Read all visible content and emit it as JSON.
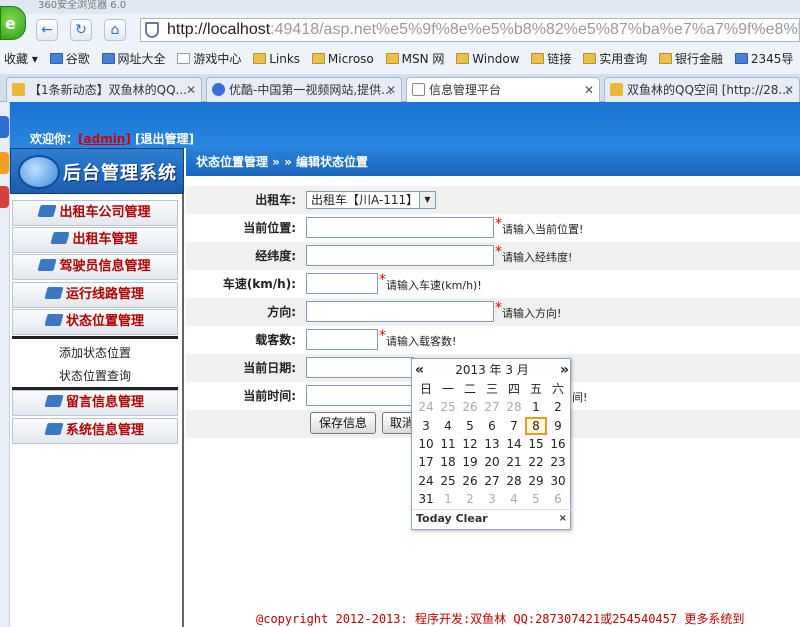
{
  "browser": {
    "title": "360安全浏览器 6.0",
    "address_host": "http://localhost",
    "address_rest": ":49418/asp.net%e5%9f%8e%e5%b8%82%e5%87%ba%e7%a7%9f%e8%bd%a6%",
    "favorites_label": "收藏",
    "favorites": [
      "谷歌",
      "网址大全",
      "游戏中心",
      "Links",
      "Microso",
      "MSN 网",
      "Window",
      "链接",
      "实用查询",
      "银行金融",
      "2345导"
    ],
    "tabs": [
      {
        "label": "【1条新动态】双鱼林的QQ..."
      },
      {
        "label": "优酷-中国第一视频网站,提供..."
      },
      {
        "label": "信息管理平台"
      },
      {
        "label": "双鱼林的QQ空间 [http://28..."
      }
    ]
  },
  "header": {
    "welcome_prefix": "欢迎你：",
    "admin_link": "[admin]",
    "logout_link": "[退出管理]",
    "system_title": "后台管理系统"
  },
  "sidebar": {
    "menus": [
      "出租车公司管理",
      "出租车管理",
      "驾驶员信息管理",
      "运行线路管理",
      "状态位置管理"
    ],
    "sub_items": [
      "添加状态位置",
      "状态位置查询"
    ],
    "menus_bottom": [
      "留言信息管理",
      "系统信息管理"
    ]
  },
  "breadcrumb": "状态位置管理 » » 编辑状态位置",
  "form": {
    "taxi": {
      "label": "出租车:",
      "value": "出租车【川A-111】"
    },
    "position": {
      "label": "当前位置:",
      "hint": "请输入当前位置!"
    },
    "lnglat": {
      "label": "经纬度:",
      "hint": "请输入经纬度!"
    },
    "speed": {
      "label": "车速(km/h):",
      "hint": "请输入车速(km/h)!"
    },
    "direction": {
      "label": "方向:",
      "hint": "请输入方向!"
    },
    "passengers": {
      "label": "载客数:",
      "hint": "请输入载客数!"
    },
    "date": {
      "label": "当前日期:"
    },
    "time": {
      "label": "当前时间:",
      "hint_tail": "间!"
    },
    "save_label": "保存信息",
    "reset_label": "取消"
  },
  "calendar": {
    "prev": "«",
    "next": "»",
    "title": "2013 年 3 月",
    "weekdays": [
      "日",
      "一",
      "二",
      "三",
      "四",
      "五",
      "六"
    ],
    "weeks": [
      [
        "24",
        "25",
        "26",
        "27",
        "28",
        "1",
        "2"
      ],
      [
        "3",
        "4",
        "5",
        "6",
        "7",
        "8",
        "9"
      ],
      [
        "10",
        "11",
        "12",
        "13",
        "14",
        "15",
        "16"
      ],
      [
        "17",
        "18",
        "19",
        "20",
        "21",
        "22",
        "23"
      ],
      [
        "24",
        "25",
        "26",
        "27",
        "28",
        "29",
        "30"
      ],
      [
        "31",
        "1",
        "2",
        "3",
        "4",
        "5",
        "6"
      ]
    ],
    "selected_day": "8",
    "today_label": "Today",
    "clear_label": "Clear",
    "close": "×"
  },
  "footer": "@copyright 2012-2013: 程序开发:双鱼林  QQ:287307421或254540457  更多系统到"
}
